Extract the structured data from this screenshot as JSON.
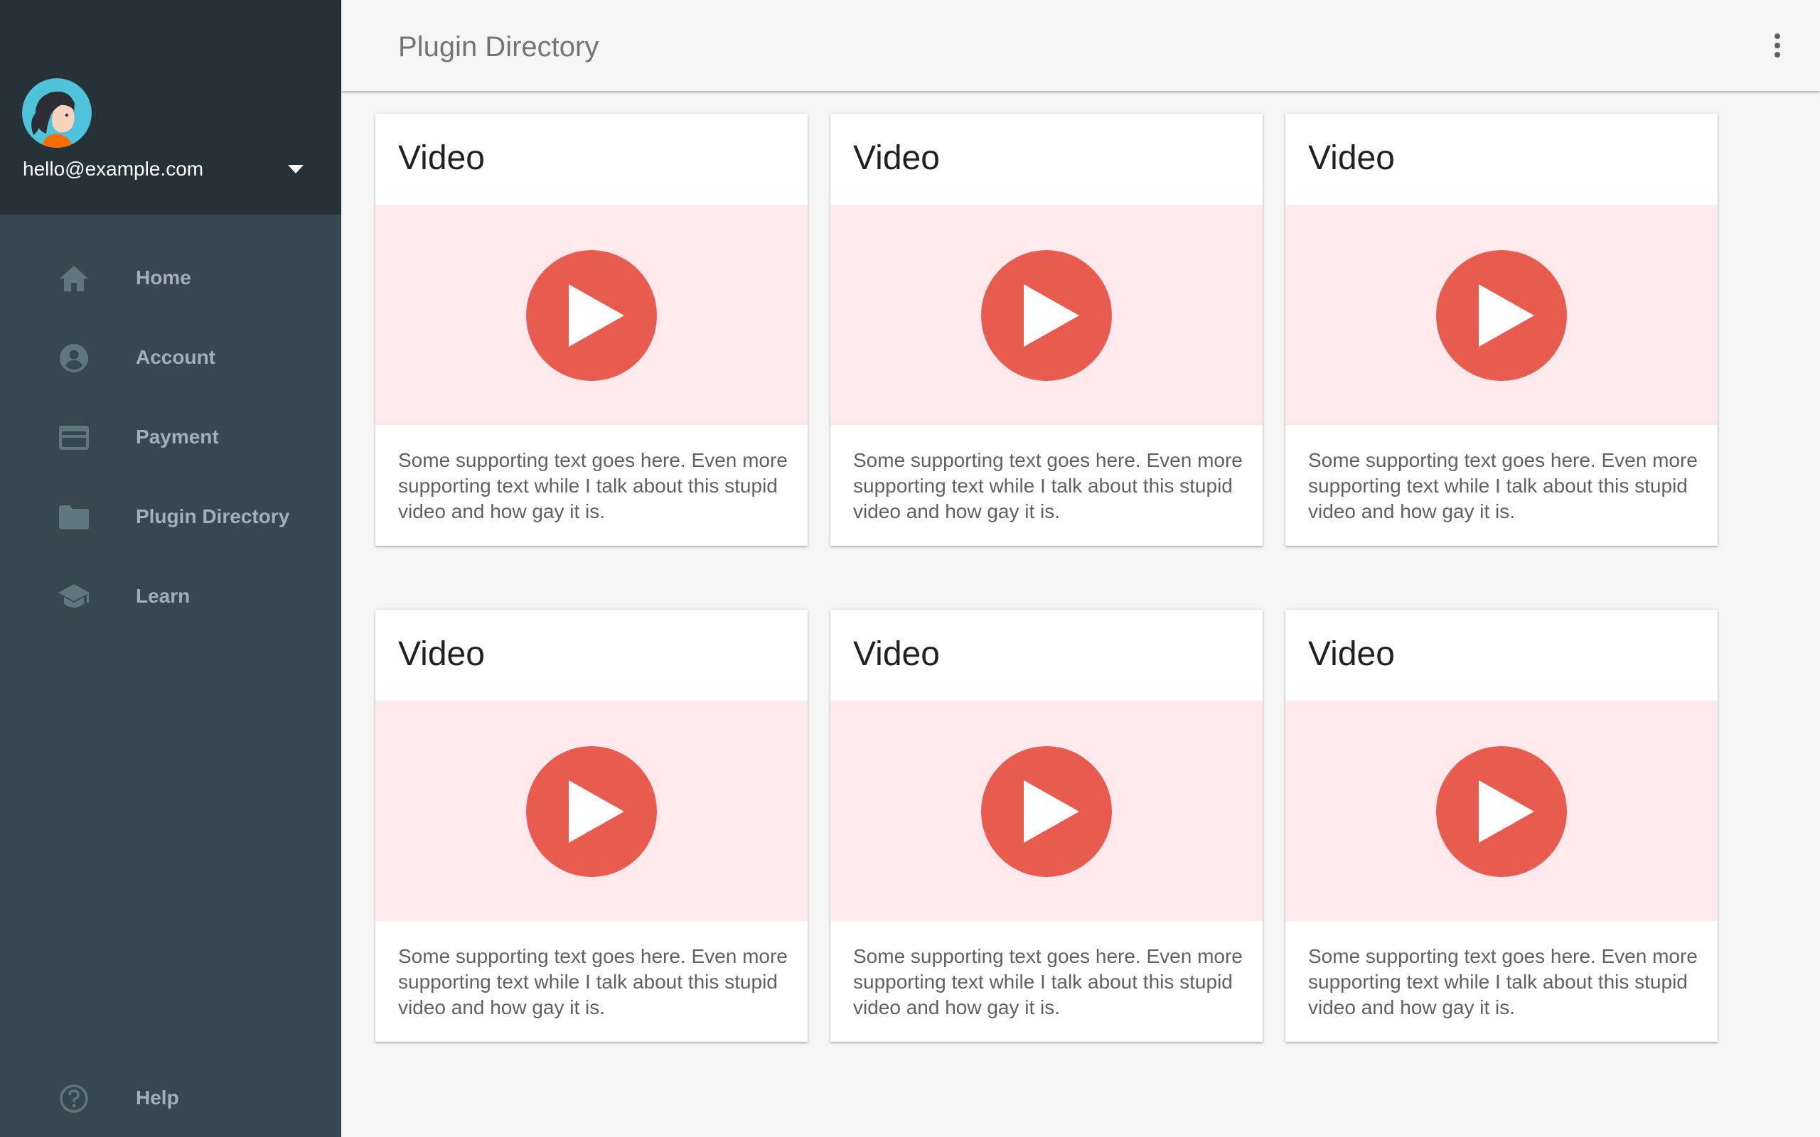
{
  "account": {
    "email": "hello@example.com",
    "avatar_icon": "user-avatar-woman",
    "dropdown_icon": "caret-down-icon"
  },
  "sidebar": {
    "items": [
      {
        "label": "Home",
        "icon": "home-icon"
      },
      {
        "label": "Account",
        "icon": "account-circle-icon"
      },
      {
        "label": "Payment",
        "icon": "credit-card-icon"
      },
      {
        "label": "Plugin Directory",
        "icon": "folder-icon"
      },
      {
        "label": "Learn",
        "icon": "school-icon"
      }
    ],
    "help": {
      "label": "Help",
      "icon": "help-circle-icon"
    }
  },
  "header": {
    "title": "Plugin Directory",
    "menu_icon": "more-vertical-icon"
  },
  "cards": [
    {
      "title": "Video",
      "text": "Some supporting text goes here. Even more supporting text while I talk about this stupid video and how gay it is."
    },
    {
      "title": "Video",
      "text": "Some supporting text goes here. Even more supporting text while I talk about this stupid video and how gay it is."
    },
    {
      "title": "Video",
      "text": "Some supporting text goes here. Even more supporting text while I talk about this stupid video and how gay it is."
    },
    {
      "title": "Video",
      "text": "Some supporting text goes here. Even more supporting text while I talk about this stupid video and how gay it is."
    },
    {
      "title": "Video",
      "text": "Some supporting text goes here. Even more supporting text while I talk about this stupid video and how gay it is."
    },
    {
      "title": "Video",
      "text": "Some supporting text goes here. Even more supporting text while I talk about this stupid video and how gay it is."
    }
  ],
  "colors": {
    "sidebar_bg": "#37474f",
    "sidebar_header_bg": "#263238",
    "nav_text": "#a1b0b8",
    "nav_icon": "#5f7580",
    "media_bg": "#ffe9ec",
    "play_red": "#e85c4f",
    "page_bg": "#f5f5f5"
  }
}
